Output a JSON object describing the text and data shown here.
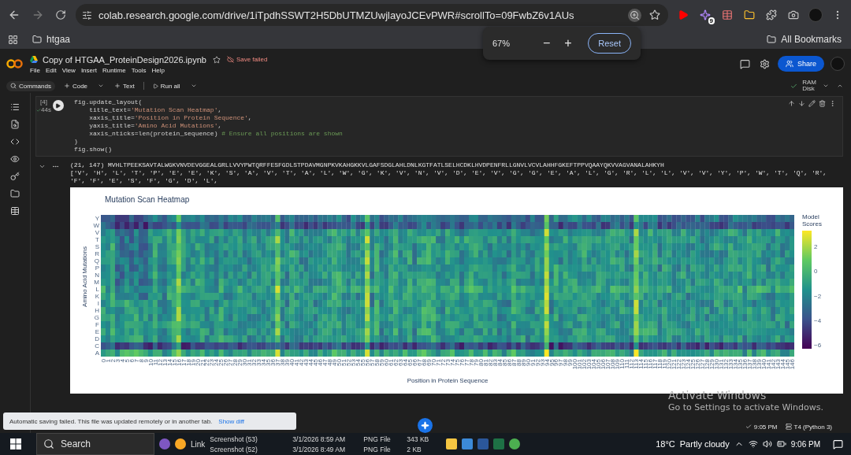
{
  "browser": {
    "url": "colab.research.google.com/drive/1iTpdhSSWT2H5DbUTMZUwjlayoJCEvPWR#scrollTo=09FwbZ6v1AUs",
    "extension_badge": "9",
    "bookmarks": [
      {
        "label": "htgaa"
      }
    ],
    "all_bookmarks": "All Bookmarks",
    "zoom_popup": {
      "percent": "67%",
      "minus": "−",
      "plus": "+",
      "reset": "Reset"
    }
  },
  "colab": {
    "title": "Copy of HTGAA_ProteinDesign2026.ipynb",
    "save_status": "Save failed",
    "menu": [
      "File",
      "Edit",
      "View",
      "Insert",
      "Runtime",
      "Tools",
      "Help"
    ],
    "share": "Share",
    "toolbar": {
      "commands": "Commands",
      "code": "Code",
      "text": "Text",
      "run_all": "Run all",
      "ram": "RAM",
      "disk": "Disk"
    }
  },
  "cell": {
    "exec_count": "[4]",
    "duration": "44s",
    "code_lines": [
      [
        {
          "t": "fig.update_layout(",
          "kind": "plain"
        }
      ],
      [
        {
          "t": "    title_text=",
          "kind": "plain"
        },
        {
          "t": "'Mutation Scan Heatmap'",
          "kind": "string"
        },
        {
          "t": ",",
          "kind": "plain"
        }
      ],
      [
        {
          "t": "    xaxis_title=",
          "kind": "plain"
        },
        {
          "t": "'Position in Protein Sequence'",
          "kind": "string"
        },
        {
          "t": ",",
          "kind": "plain"
        }
      ],
      [
        {
          "t": "    yaxis_title=",
          "kind": "plain"
        },
        {
          "t": "'Amino Acid Mutations'",
          "kind": "string"
        },
        {
          "t": ",",
          "kind": "plain"
        }
      ],
      [
        {
          "t": "    xaxis_nticks=len(protein_sequence) ",
          "kind": "plain"
        },
        {
          "t": "# Ensure all positions are shown",
          "kind": "comment"
        }
      ],
      [
        {
          "t": ")",
          "kind": "plain"
        }
      ],
      [
        {
          "t": "fig.show()",
          "kind": "plain"
        }
      ]
    ]
  },
  "output": {
    "lines": [
      "(21, 147) MVHLTPEEKSAVTALWGKVNVDEVGGEALGRLLVVYPWTQRFFESFGDLSTPDAVMGNPKVKAHGKKVLGAFSDGLAHLDNLKGTFATLSELHCDKLHVDPENFRLLGNVLVCVLAHHFGKEFTPPVQAAYQKVVAGVANALAHKYH",
      "['V', 'H', 'L', 'T', 'P', 'E', 'E', 'K', 'S', 'A', 'V', 'T', 'A', 'L', 'W', 'G', 'K', 'V', 'N', 'V', 'D', 'E', 'V', 'G', 'G', 'E', 'A', 'L', 'G', 'R', 'L', 'L', 'V', 'V', 'Y', 'P', 'W', 'T', 'Q', 'R', 'F', 'F', 'E', 'S', 'F', 'G', 'D', 'L',"
    ],
    "heatmap": {
      "title": "Mutation Scan Heatmap",
      "xlabel": "Position in Protein Sequence",
      "ylabel": "Amino Acid Mutations",
      "yticks": [
        "Y",
        "W",
        "V",
        "T",
        "S",
        "R",
        "Q",
        "P",
        "N",
        "M",
        "L",
        "K",
        "I",
        "H",
        "G",
        "F",
        "E",
        "D",
        "C",
        "A"
      ],
      "xticks": [
        "0",
        "1",
        "2",
        "3",
        "4",
        "5",
        "6",
        "7",
        "8",
        "9",
        "10",
        "11",
        "12",
        "13",
        "14",
        "15",
        "16",
        "17",
        "18",
        "19",
        "20",
        "21",
        "22",
        "23",
        "24",
        "25",
        "26",
        "27",
        "28",
        "29",
        "30",
        "31",
        "32",
        "33",
        "34",
        "35",
        "36",
        "37",
        "38",
        "39",
        "40",
        "41",
        "42",
        "43",
        "44",
        "45",
        "46",
        "47",
        "48",
        "49",
        "50",
        "51",
        "52",
        "53",
        "54",
        "55",
        "56",
        "57",
        "58",
        "59",
        "60",
        "61",
        "62",
        "63",
        "64",
        "65",
        "66",
        "67",
        "68",
        "69",
        "70",
        "71",
        "72",
        "73",
        "74",
        "75",
        "76",
        "77",
        "78",
        "79",
        "80",
        "81",
        "82",
        "83",
        "84",
        "85",
        "86",
        "87",
        "88",
        "89",
        "90",
        "91",
        "92",
        "93",
        "94",
        "95",
        "96",
        "97",
        "98",
        "99",
        "100",
        "101",
        "102",
        "103",
        "104",
        "105",
        "106",
        "107",
        "108",
        "109",
        "110",
        "111",
        "112",
        "113",
        "114",
        "115",
        "116",
        "117",
        "118",
        "119",
        "120",
        "121",
        "122",
        "123",
        "124",
        "125",
        "126",
        "127",
        "128",
        "129",
        "130",
        "131",
        "132",
        "133",
        "134",
        "135",
        "136",
        "137",
        "138",
        "139",
        "140",
        "141",
        "142",
        "143",
        "144",
        "145",
        "146"
      ],
      "colorbar": {
        "title": "Model Scores",
        "ticks": [
          "2",
          "0",
          "−2",
          "−4",
          "−6"
        ]
      }
    }
  },
  "toast": {
    "message": "Automatic saving failed. This file was updated remotely or in another tab.",
    "action": "Show diff"
  },
  "status": {
    "time": "9:05 PM",
    "runtime": "T4 (Python 3)"
  },
  "watermark": {
    "title": "Activate Windows",
    "subtitle": "Go to Settings to activate Windows."
  },
  "taskbar": {
    "search": "Search",
    "link": "Link",
    "files": [
      {
        "name": "Screenshot (53)",
        "date": "3/1/2026 8:59 AM",
        "type": "PNG File",
        "size": "343 KB"
      },
      {
        "name": "Screenshot (52)",
        "date": "3/1/2026 8:49 AM",
        "type": "PNG File",
        "size": "2 KB"
      }
    ],
    "weather": {
      "temp": "18°C",
      "text": "Partly cloudy"
    },
    "time": "9:06 PM"
  }
}
